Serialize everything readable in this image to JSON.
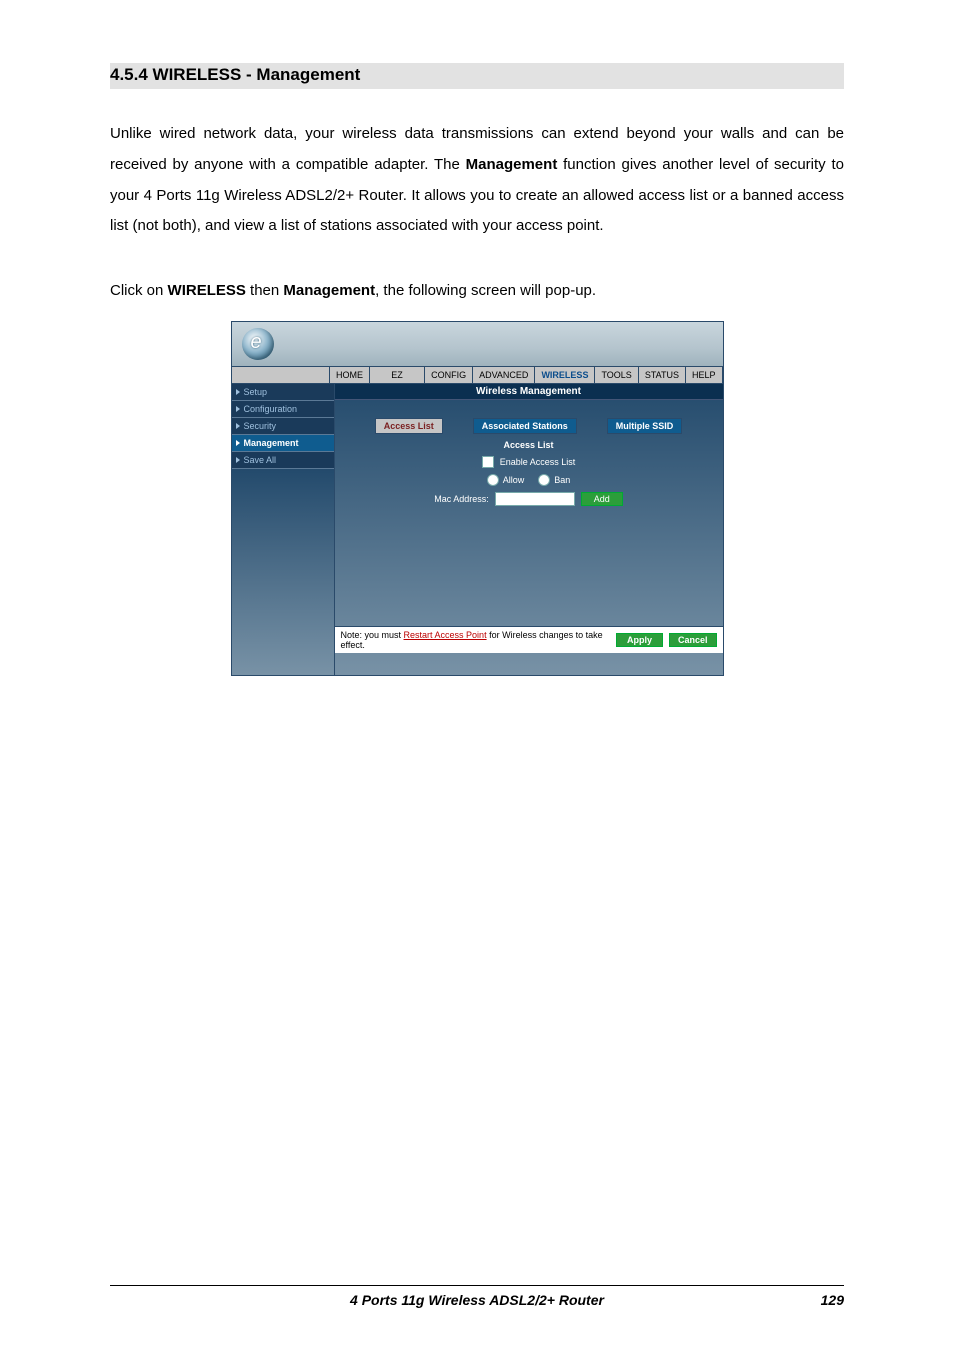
{
  "doc": {
    "section_title": "4.5.4 WIRELESS - Management",
    "para1_a": "Unlike wired network data, your wireless data transmissions can extend beyond your walls and can be received by anyone with a compatible adapter. The ",
    "para1_bold": "Management",
    "para1_b": " function gives another level of security to your 4 Ports 11g Wireless ADSL2/2+ Router. It allows you to create an allowed access list or a banned access list (not both), and view a list of stations associated with your access point.",
    "para2_a": "Click on ",
    "para2_b1": "WIRELESS",
    "para2_c": " then ",
    "para2_b2": "Management",
    "para2_d": ", the following screen will pop-up.",
    "footer_title": "4 Ports 11g Wireless ADSL2/2+ Router",
    "footer_page": "129"
  },
  "shot": {
    "logo_letter": "e",
    "topnav": [
      "HOME",
      "EZ SETUP",
      "CONFIG",
      "ADVANCED",
      "WIRELESS",
      "TOOLS",
      "STATUS",
      "HELP"
    ],
    "topnav_active_index": 4,
    "sidebar": [
      "Setup",
      "Configuration",
      "Security",
      "Management",
      "Save All"
    ],
    "sidebar_active_index": 3,
    "main_title": "Wireless Management",
    "subtabs": {
      "access_list": "Access List",
      "assoc": "Associated Stations",
      "mssid": "Multiple SSID"
    },
    "access_list_title": "Access List",
    "enable_label": "Enable Access List",
    "allow_label": "Allow",
    "ban_label": "Ban",
    "mac_label": "Mac Address:",
    "add_label": "Add",
    "note_a": "Note: you must ",
    "note_link": "Restart Access Point",
    "note_b": " for Wireless changes to take effect.",
    "apply_label": "Apply",
    "cancel_label": "Cancel"
  }
}
